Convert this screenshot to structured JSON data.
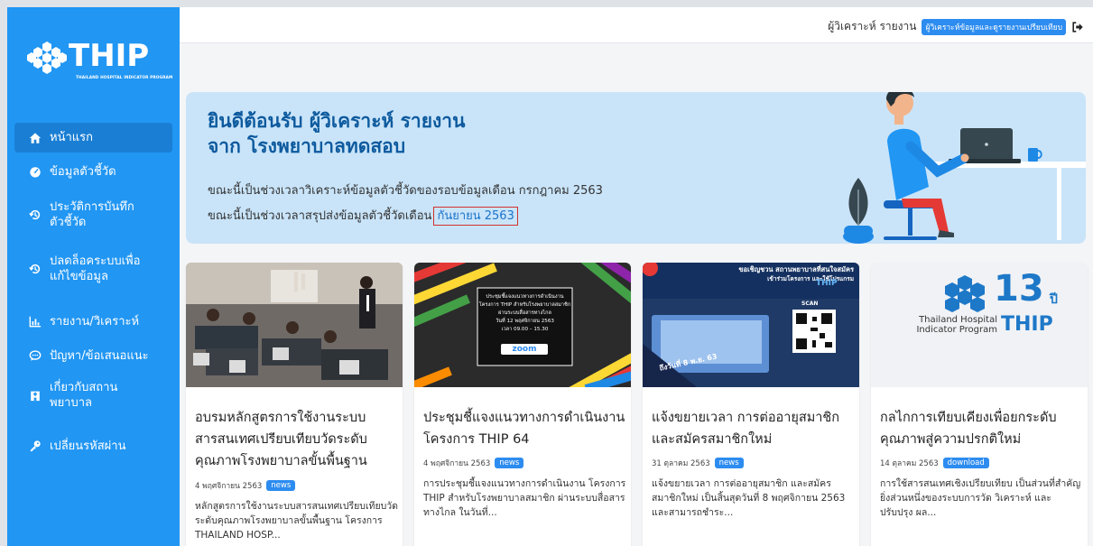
{
  "sidebar": {
    "logo": {
      "text": "THIP",
      "subtitle": "THAILAND HOSPITAL INDICATOR PROGRAM"
    },
    "items": [
      {
        "label": "หน้าแรก",
        "icon": "home-icon",
        "active": true
      },
      {
        "label": "ข้อมูลตัวชี้วัด",
        "icon": "dashboard-icon",
        "active": false
      },
      {
        "label": "ประวัติการบันทึก\nตัวชี้วัด",
        "icon": "history-icon",
        "active": false
      },
      {
        "label": "ปลดล็อคระบบเพื่อ\nแก้ไขข้อมูล",
        "icon": "history-icon",
        "active": false
      },
      {
        "label": "รายงาน/วิเคราะห์",
        "icon": "chart-icon",
        "active": false
      },
      {
        "label": "ปัญหา/ข้อเสนอแนะ",
        "icon": "comment-icon",
        "active": false
      },
      {
        "label": "เกี่ยวกับสถาน\nพยาบาล",
        "icon": "hospital-icon",
        "active": false
      },
      {
        "label": "เปลี่ยนรหัสผ่าน",
        "icon": "key-icon",
        "active": false
      }
    ]
  },
  "topbar": {
    "user_name": "ผู้วิเคราะห์ รายงาน",
    "role": "ผู้วิเคราะห์ข้อมูลและดูรายงานเปรียบเทียบ",
    "logout_icon": "logout-icon"
  },
  "hero": {
    "title_line1": "ยินดีต้อนรับ ผู้วิเคราะห์ รายงาน",
    "title_line2": "จาก โรงพยาบาลทดสอบ",
    "line1": "ขณะนี้เป็นช่วงเวลาวิเคราะห์ข้อมูลตัวชี้วัดของรอบข้อมูลเดือน กรกฎาคม 2563",
    "line2_prefix": "ขณะนี้เป็นช่วงเวลาสรุปส่งข้อมูลตัวชี้วัดเดือน",
    "line2_month": "กันยายน 2563"
  },
  "cards": [
    {
      "title": "อบรมหลักสูตรการใช้งานระบบสารสนเทศเปรียบเทียบวัดระดับคุณภาพโรงพยาบาลขั้นพื้นฐาน",
      "date": "4 พฤศจิกายน 2563",
      "tag": "news",
      "desc": "หลักสูตรการใช้งานระบบสารสนเทศเปรียบเทียบวัดระดับคุณภาพโรงพยาบาลขั้นพื้นฐาน โครงการ THAILAND HOSP..."
    },
    {
      "title": "ประชุมชี้แจงแนวทางการดำเนินงาน โครงการ THIP 64",
      "date": "4 พฤศจิกายน 2563",
      "tag": "news",
      "desc": "การประชุมชี้แจงแนวทางการดำเนินงาน โครงการ THIP สำหรับโรงพยาบาลสมาชิก ผ่านระบบสื่อสารทางไกล ในวันที่...",
      "image_text": [
        "ประชุมชี้แจงแนวทางการดำเนินงาน",
        "โครงการ THIP สำหรับโรงพยาบาลสมาชิก",
        "ผ่านระบบสื่อสารทางไกล",
        "วันที่ 12 พฤศจิกายน 2563",
        "เวลา 09.00 – 15.30"
      ],
      "image_brand": "zoom"
    },
    {
      "title": "แจ้งขยายเวลา การต่ออายุสมาชิก และสมัครสมาชิกใหม่",
      "date": "31 ตุลาคม 2563",
      "tag": "news",
      "desc": "แจ้งขยายเวลา การต่ออายุสมาชิก และสมัครสมาชิกใหม่ เป็นสิ้นสุดวันที่ 8 พฤศจิกายน 2563 และสามารถชำระ...",
      "image_text": [
        "ขอเชิญชวน สถานพยาบาลที่สนใจสมัคร",
        "เข้าร่วมโครงการ และใช้โปรแกรม",
        "SCAN",
        "ถึงวันที่ 8 พ.ย. 63"
      ],
      "image_brand": "THIP"
    },
    {
      "title": "กลไกการเทียบเคียงเพื่อยกระดับคุณภาพสู่ความปรกติใหม่",
      "date": "14 ตุลาคม 2563",
      "tag": "download",
      "desc": "การใช้สารสนเทศเชิงเปรียบเทียบ เป็นส่วนที่สำคัญยิ่งส่วนหนึ่งของระบบการวัด วิเคราะห์ และปรับปรุง ผล...",
      "image_text": [
        "13",
        "ปี",
        "Thailand Hospital",
        "Indicator Program",
        "THIP"
      ]
    }
  ],
  "colors": {
    "sidebar": "#2196f3",
    "accent": "#2d8cf0",
    "hero_bg": "#c9e4f9",
    "hero_title": "#0d5a9e"
  }
}
